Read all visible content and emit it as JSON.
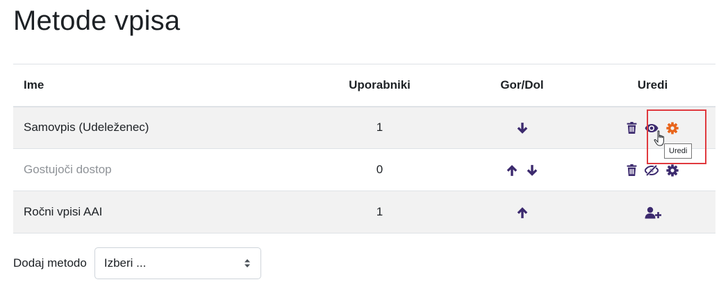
{
  "page": {
    "title": "Metode vpisa"
  },
  "table": {
    "headers": {
      "name": "Ime",
      "users": "Uporabniki",
      "order": "Gor/Dol",
      "edit": "Uredi"
    },
    "rows": [
      {
        "name": "Samovpis (Udeleženec)",
        "users": "1",
        "enabled": true,
        "order_actions": [
          "move-down"
        ],
        "edit_actions": [
          "delete",
          "hide",
          "settings"
        ]
      },
      {
        "name": "Gostujoči dostop",
        "users": "0",
        "enabled": false,
        "order_actions": [
          "move-up",
          "move-down"
        ],
        "edit_actions": [
          "delete",
          "show",
          "settings"
        ]
      },
      {
        "name": "Ročni vpisi AAI",
        "users": "1",
        "enabled": true,
        "order_actions": [
          "move-up"
        ],
        "edit_actions": [
          "enrol-users"
        ]
      }
    ]
  },
  "tooltip": {
    "text": "Uredi"
  },
  "add_method": {
    "label": "Dodaj metodo",
    "selected": "Izberi ..."
  },
  "colors": {
    "icon": "#3c2a6e",
    "icon_active": "#e8641b",
    "highlight": "#e0393e",
    "row_stripe": "#f2f2f2"
  },
  "icons": {
    "move-up": "arrow-up-icon",
    "move-down": "arrow-down-icon",
    "delete": "trash-icon",
    "hide": "eye-icon",
    "show": "eye-slash-icon",
    "settings": "gear-icon",
    "enrol-users": "user-plus-icon"
  }
}
